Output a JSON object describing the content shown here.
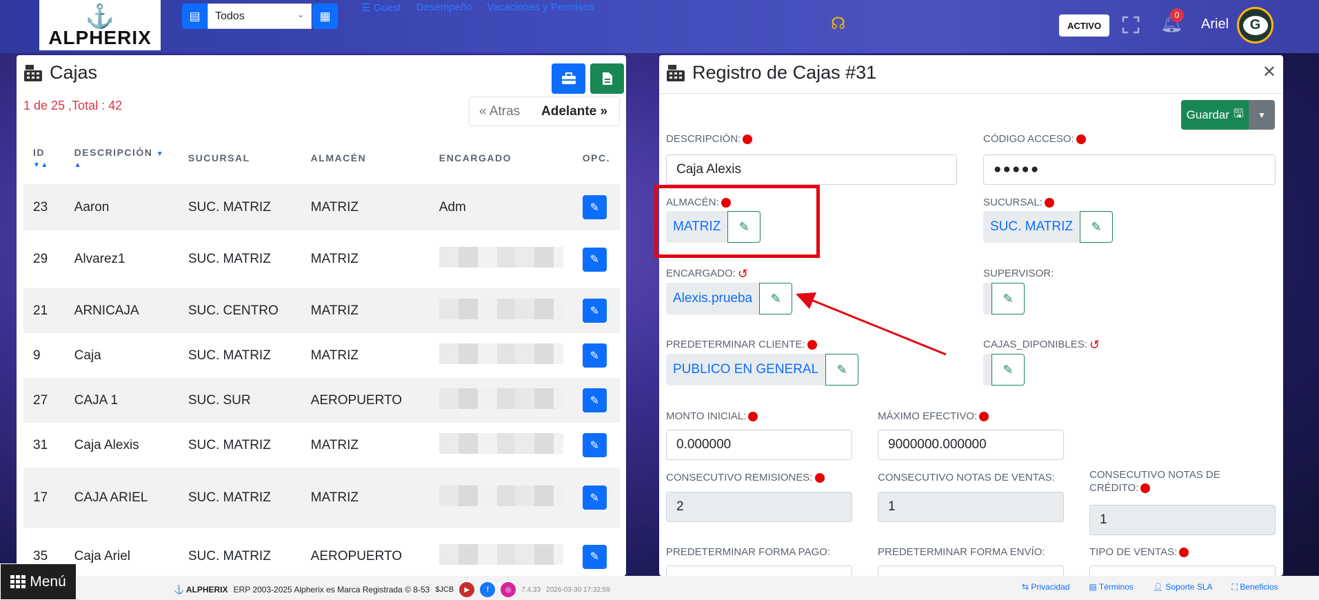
{
  "topbar": {
    "brand": "ALPHERIX",
    "select_value": "Todos",
    "links": [
      "Guest",
      "Desempeño",
      "Vacaciones y Permisos"
    ],
    "status": "ACTIVO",
    "notifications": "0",
    "user": "Ariel",
    "avatar_letter": "G"
  },
  "left": {
    "title": "Cajas",
    "count": "1 de 25 ,Total : 42",
    "prev": "« Atras",
    "next": "Adelante »",
    "columns": [
      "ID",
      "DESCRIPCIÓN",
      "SUCURSAL",
      "ALMACÉN",
      "ENCARGADO",
      "OPC."
    ],
    "rows": [
      {
        "id": "23",
        "desc": "Aaron",
        "suc": "SUC. MATRIZ",
        "alm": "MATRIZ",
        "enc": "Adm"
      },
      {
        "id": "29",
        "desc": "Alvarez1",
        "suc": "SUC. MATRIZ",
        "alm": "MATRIZ",
        "enc": ""
      },
      {
        "id": "21",
        "desc": "ARNICAJA",
        "suc": "SUC. CENTRO",
        "alm": "MATRIZ",
        "enc": ""
      },
      {
        "id": "9",
        "desc": "Caja",
        "suc": "SUC. MATRIZ",
        "alm": "MATRIZ",
        "enc": ""
      },
      {
        "id": "27",
        "desc": "CAJA 1",
        "suc": "SUC. SUR",
        "alm": "AEROPUERTO",
        "enc": ""
      },
      {
        "id": "31",
        "desc": "Caja Alexis",
        "suc": "SUC. MATRIZ",
        "alm": "MATRIZ",
        "enc": ""
      },
      {
        "id": "17",
        "desc": "CAJA ARIEL",
        "suc": "SUC. MATRIZ",
        "alm": "MATRIZ",
        "enc": ""
      },
      {
        "id": "35",
        "desc": "Caja Ariel",
        "suc": "SUC. MATRIZ",
        "alm": "AEROPUERTO",
        "enc": ""
      }
    ]
  },
  "right": {
    "title": "Registro de Cajas #31",
    "save": "Guardar",
    "descripcion_label": "DESCRIPCIÓN:",
    "descripcion": "Caja Alexis",
    "codigo_label": "CÓDIGO ACCESO:",
    "codigo": "●●●●●",
    "almacen_label": "ALMACÉN:",
    "almacen": "MATRIZ",
    "sucursal_label": "SUCURSAL:",
    "sucursal": "SUC. MATRIZ",
    "encargado_label": "ENCARGADO:",
    "encargado": "Alexis.prueba",
    "supervisor_label": "SUPERVISOR:",
    "cliente_label": "PREDETERMINAR CLIENTE:",
    "cliente": "PUBLICO EN GENERAL",
    "cajas_label": "CAJAS_DIPONIBLES:",
    "monto_label": "MONTO INICIAL:",
    "monto": "0.000000",
    "maximo_label": "MÁXIMO EFECTIVO:",
    "maximo": "9000000.000000",
    "cons_rem_label": "CONSECUTIVO REMISIONES:",
    "cons_rem": "2",
    "cons_nv_label": "CONSECUTIVO NOTAS DE VENTAS:",
    "cons_nv": "1",
    "cons_nc_label_1": "CONSECUTIVO NOTAS DE",
    "cons_nc_label_2": "CRÉDITO:",
    "cons_nc": "1",
    "forma_pago_label": "PREDETERMINAR FORMA PAGO:",
    "forma_envio_label": "PREDETERMINAR FORMA ENVÍO:",
    "tipo_ventas_label": "TIPO DE VENTAS:"
  },
  "footer": {
    "menu": "Menú",
    "brand": "ALPHERIX",
    "copyright": "ERP 2003-2025 Alpherix es Marca Registrada © 8-53",
    "version": "7.4.33",
    "datetime": "2026-03-30 17:32:59",
    "links": [
      "Privacidad",
      "Términos",
      "Soporte SLA",
      "Beneficios"
    ]
  }
}
